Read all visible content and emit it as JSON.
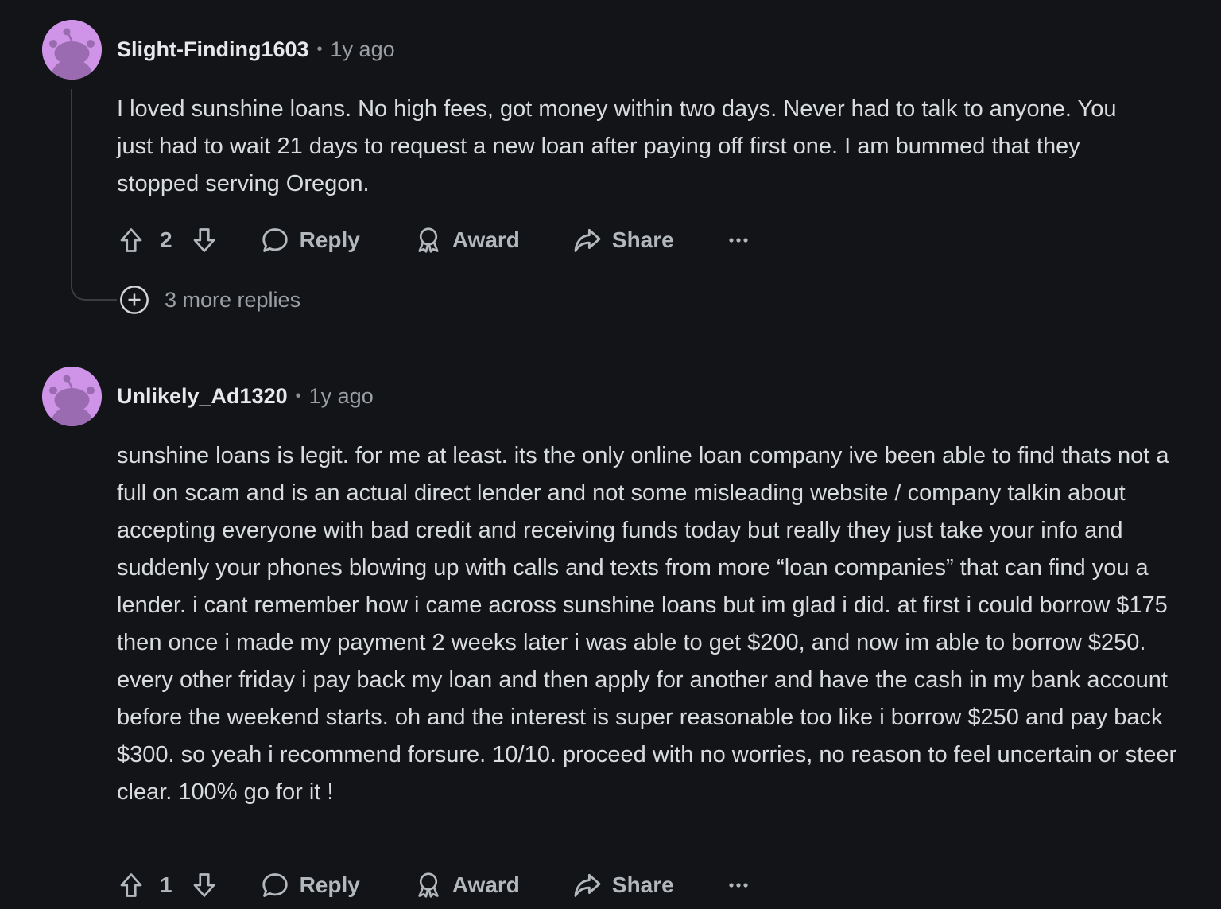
{
  "comments": [
    {
      "username": "Slight-Finding1603",
      "time": "1y ago",
      "body": "I loved sunshine loans. No high fees, got money within two days. Never had to talk to anyone. You just had to wait 21 days to request a new loan after paying off first one. I am bummed that they stopped serving Oregon.",
      "votes": "2",
      "more_replies": "3 more replies"
    },
    {
      "username": "Unlikely_Ad1320",
      "time": "1y ago",
      "body": "sunshine loans is legit. for me at least. its the only online loan company ive been able to find thats not a full on scam and is an actual direct lender and not some misleading website / company talkin about accepting everyone with bad credit and receiving funds today but really they just take your info and suddenly your phones blowing up with calls and texts from more “loan companies” that can find you a lender. i cant remember how i came across sunshine loans but im glad i did. at first i could borrow $175 then once i made my payment 2 weeks later i was able to get $200, and now im able to borrow $250. every other friday i pay back my loan and then apply for another and have the cash in my bank account before the weekend starts. oh and the interest is super reasonable too like i borrow $250 and pay back $300. so yeah i recommend forsure. 10/10. proceed with no worries, no reason to feel uncertain or steer clear. 100% go for it !",
      "votes": "1"
    }
  ],
  "actions": {
    "reply": "Reply",
    "award": "Award",
    "share": "Share"
  },
  "meta_separator": "•",
  "icons": {
    "avatar": "snoo-avatar-icon",
    "upvote": "upvote-arrow-icon",
    "downvote": "downvote-arrow-icon",
    "reply": "speech-bubble-icon",
    "award": "award-ribbon-icon",
    "share": "share-arrow-icon",
    "more": "ellipsis-icon",
    "expand": "plus-circle-icon"
  },
  "colors": {
    "background": "#131417",
    "avatar": "#cf94e8",
    "text": "#d9dcde",
    "muted": "#9aa0a4"
  }
}
